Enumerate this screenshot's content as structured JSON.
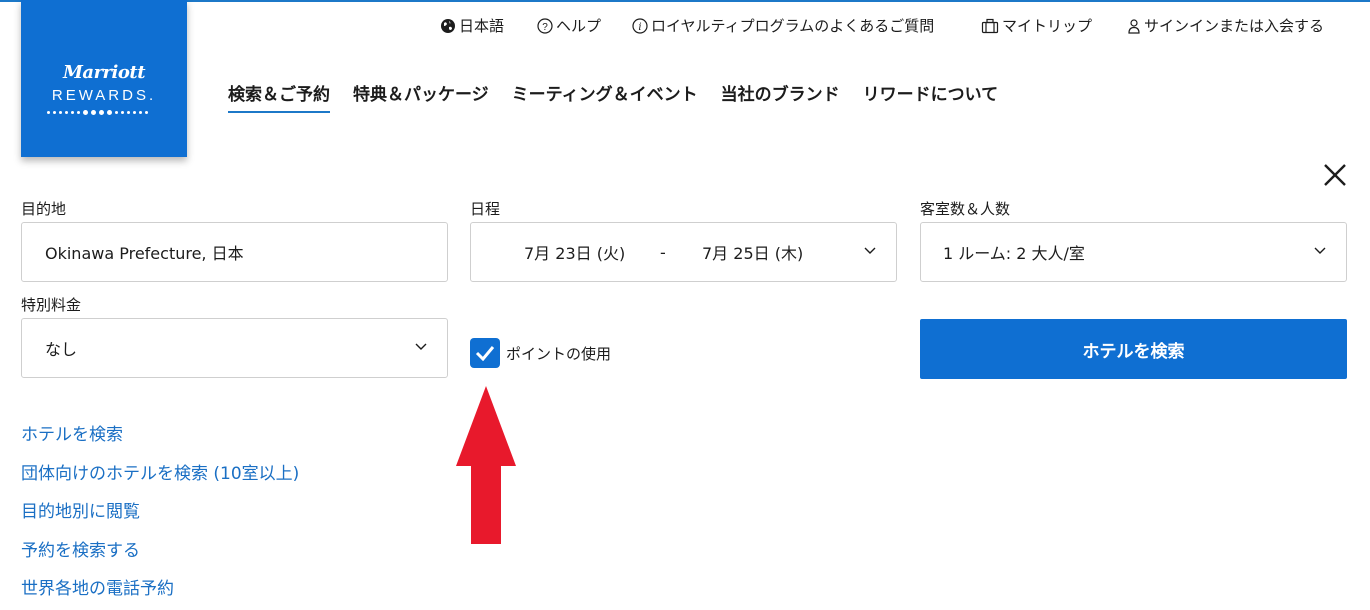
{
  "logo": {
    "brand": "Marriott",
    "sub": "REWARDS."
  },
  "utility_nav": [
    {
      "label": "日本語",
      "icon": "globe-icon"
    },
    {
      "label": "ヘルプ",
      "icon": "help-icon"
    },
    {
      "label": "ロイヤルティプログラムのよくあるご質問",
      "icon": "info-icon"
    },
    {
      "label": "マイトリップ",
      "icon": "briefcase-icon"
    },
    {
      "label": "サインインまたは入会する",
      "icon": "user-icon"
    }
  ],
  "main_nav": [
    {
      "label": "検索＆ご予約",
      "active": true
    },
    {
      "label": "特典＆パッケージ"
    },
    {
      "label": "ミーティング＆イベント"
    },
    {
      "label": "当社のブランド"
    },
    {
      "label": "リワードについて"
    }
  ],
  "form": {
    "destination": {
      "label": "目的地",
      "value": "Okinawa Prefecture, 日本"
    },
    "dates": {
      "label": "日程",
      "check_in": "7月 23日 (火)",
      "separator": "-",
      "check_out": "7月 25日 (木)"
    },
    "guests": {
      "label": "客室数＆人数",
      "value": "1 ルーム: 2 大人/室"
    },
    "special_rate": {
      "label": "特別料金",
      "value": "なし"
    },
    "use_points": {
      "label": "ポイントの使用",
      "checked": true
    },
    "search_button": "ホテルを検索"
  },
  "links": [
    "ホテルを検索",
    "団体向けのホテルを検索 (10室以上)",
    "目的地別に閲覧",
    "予約を検索する",
    "世界各地の電話予約"
  ],
  "colors": {
    "brand_blue": "#0f6fd2",
    "link_blue": "#1a6fc4",
    "annotation_red": "#e8192c"
  }
}
